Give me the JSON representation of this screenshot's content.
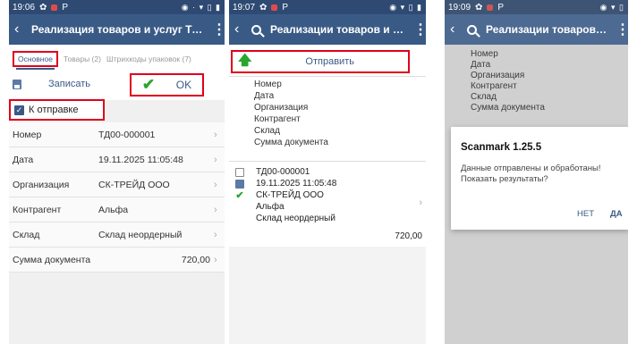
{
  "screen1": {
    "status_time": "19:06",
    "title": "Реализация товаров и услуг ТД...",
    "tabs": [
      {
        "label": "Основное"
      },
      {
        "label": "Товары (2)"
      },
      {
        "label": "Штрихкоды упаковок (7)"
      }
    ],
    "save_label": "Записать",
    "ok_label": "OK",
    "send_checkbox_label": "К отправке",
    "send_checked": true,
    "fields": [
      {
        "label": "Номер",
        "value": "ТД00-000001"
      },
      {
        "label": "Дата",
        "value": "19.11.2025 11:05:48"
      },
      {
        "label": "Организация",
        "value": "СК-ТРЕЙД ООО"
      },
      {
        "label": "Контрагент",
        "value": "Альфа"
      },
      {
        "label": "Склад",
        "value": "Склад неордерный"
      },
      {
        "label": "Сумма документа",
        "value": "720,00"
      }
    ]
  },
  "screen2": {
    "status_time": "19:07",
    "title": "Реализации товаров и усл...",
    "send_label": "Отправить",
    "columns": [
      "Номер",
      "Дата",
      "Организация",
      "Контрагент",
      "Склад",
      "Сумма документа"
    ],
    "document": {
      "number": "ТД00-000001",
      "date": "19.11.2025 11:05:48",
      "organization": "СК-ТРЕЙД ООО",
      "counterparty": "Альфа",
      "warehouse": "Склад неордерный",
      "sum": "720,00"
    }
  },
  "screen3": {
    "status_time": "19:09",
    "title": "Реализации товаров и усл...",
    "columns": [
      "Номер",
      "Дата",
      "Организация",
      "Контрагент",
      "Склад",
      "Сумма документа"
    ],
    "dialog": {
      "title": "Scanmark 1.25.5",
      "message": "Данные отправлены и обработаны! Показать результаты?",
      "no_label": "НЕТ",
      "yes_label": "ДА"
    }
  },
  "colors": {
    "appbar": "#3a5a86",
    "statusbar": "#2e4a73",
    "accent": "#2aa52e",
    "highlight": "#e0001b"
  }
}
